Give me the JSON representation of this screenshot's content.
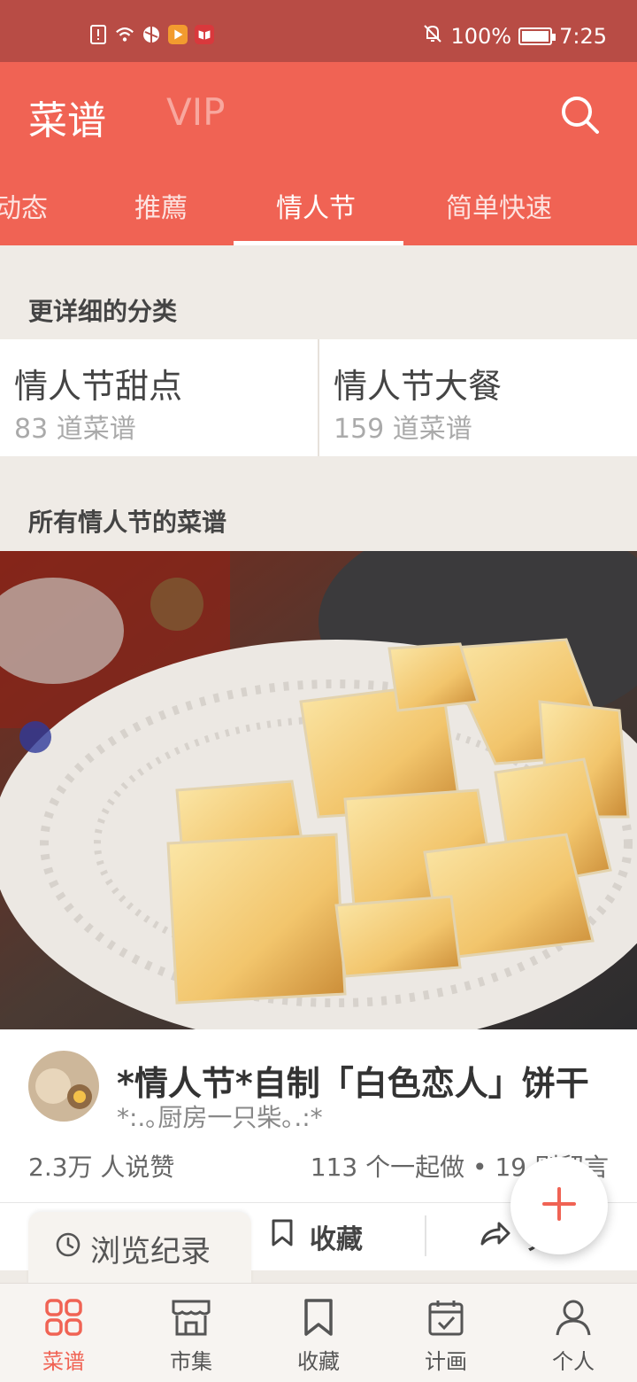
{
  "status_bar": {
    "battery": "100%",
    "time": "7:25"
  },
  "header": {
    "brand": "菜谱",
    "vip": "VIP"
  },
  "tabs": [
    {
      "label": "动态"
    },
    {
      "label": "推薦"
    },
    {
      "label": "情人节"
    },
    {
      "label": "简单快速"
    }
  ],
  "active_tab": "情人节",
  "categories_section": {
    "title": "更详细的分类"
  },
  "categories": [
    {
      "name": "情人节甜点",
      "count": "83 道菜谱"
    },
    {
      "name": "情人节大餐",
      "count": "159 道菜谱"
    }
  ],
  "recipes_section": {
    "title": "所有情人节的菜谱"
  },
  "recipe": {
    "title": "*情人节*自制「白色恋人」饼干",
    "author": "*:.｡厨房一只柴｡.:*",
    "likes": "2.3万 人说赞",
    "stats": "113 个一起做 • 19 则留言",
    "save_label": "收藏",
    "share_label": "分享"
  },
  "history_label": "浏览纪录",
  "bottom_nav": [
    {
      "label": "菜谱",
      "icon": "grid-icon"
    },
    {
      "label": "市集",
      "icon": "shop-icon"
    },
    {
      "label": "收藏",
      "icon": "bookmark-icon"
    },
    {
      "label": "计画",
      "icon": "calendar-icon"
    },
    {
      "label": "个人",
      "icon": "person-icon"
    }
  ],
  "colors": {
    "primary": "#f06354",
    "status_bar": "#b84c45",
    "background": "#efebe6"
  }
}
